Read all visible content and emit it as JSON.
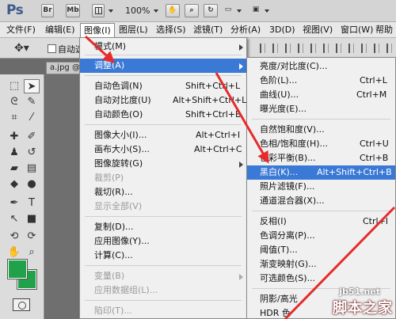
{
  "titlebar": {
    "logo": "Ps",
    "br": "Br",
    "mb": "Mb",
    "zoom": "100%"
  },
  "menubar": {
    "items": [
      "文件(F)",
      "编辑(E)",
      "图像(I)",
      "图层(L)",
      "选择(S)",
      "滤镜(T)",
      "分析(A)",
      "3D(D)",
      "视图(V)",
      "窗口(W)",
      "帮助"
    ]
  },
  "options": {
    "auto_select": "自动选"
  },
  "doc_tab": "a.jpg @",
  "image_menu": {
    "mode": "模式(M)",
    "adjust": "调整(A)",
    "auto_tone": {
      "label": "自动色调(N)",
      "shortcut": "Shift+Ctrl+L"
    },
    "auto_contrast": {
      "label": "自动对比度(U)",
      "shortcut": "Alt+Shift+Ctrl+L"
    },
    "auto_color": {
      "label": "自动颜色(O)",
      "shortcut": "Shift+Ctrl+B"
    },
    "image_size": {
      "label": "图像大小(I)...",
      "shortcut": "Alt+Ctrl+I"
    },
    "canvas_size": {
      "label": "画布大小(S)...",
      "shortcut": "Alt+Ctrl+C"
    },
    "rotate": "图像旋转(G)",
    "crop_dis": "裁剪(P)",
    "trim": "裁切(R)...",
    "reveal_all": "显示全部(V)",
    "duplicate": "复制(D)...",
    "apply_image": "应用图像(Y)...",
    "calculations": "计算(C)...",
    "variables": "变量(B)",
    "apply_data": "应用数据组(L)...",
    "trap": "陷印(T)..."
  },
  "adjust_menu": {
    "brightness": {
      "label": "亮度/对比度(C)...",
      "shortcut": ""
    },
    "levels": {
      "label": "色阶(L)...",
      "shortcut": "Ctrl+L"
    },
    "curves": {
      "label": "曲线(U)...",
      "shortcut": "Ctrl+M"
    },
    "exposure": {
      "label": "曝光度(E)...",
      "shortcut": ""
    },
    "vibrance": {
      "label": "自然饱和度(V)...",
      "shortcut": ""
    },
    "hue_sat": {
      "label": "色相/饱和度(H)...",
      "shortcut": "Ctrl+U"
    },
    "color_balance": {
      "label": "色彩平衡(B)...",
      "shortcut": "Ctrl+B"
    },
    "black_white": {
      "label": "黑白(K)...",
      "shortcut": "Alt+Shift+Ctrl+B"
    },
    "photo_filter": {
      "label": "照片滤镜(F)...",
      "shortcut": ""
    },
    "channel_mixer": {
      "label": "通道混合器(X)...",
      "shortcut": ""
    },
    "invert": {
      "label": "反相(I)",
      "shortcut": "Ctrl+I"
    },
    "posterize": {
      "label": "色调分离(P)...",
      "shortcut": ""
    },
    "threshold": {
      "label": "阈值(T)...",
      "shortcut": ""
    },
    "gradient_map": {
      "label": "渐变映射(G)...",
      "shortcut": ""
    },
    "selective_color": {
      "label": "可选颜色(S)...",
      "shortcut": ""
    },
    "shadows": {
      "label": "阴影/高光",
      "shortcut": ""
    },
    "hdr": {
      "label": "HDR 色",
      "shortcut": ""
    }
  },
  "colors": {
    "highlight": "#3a79d6",
    "foreground": "#21a24a",
    "background": "#21a24a",
    "annotation_arrow": "#e52b2b"
  },
  "watermark": {
    "site": "jb51.net",
    "name": "脚本之家"
  }
}
